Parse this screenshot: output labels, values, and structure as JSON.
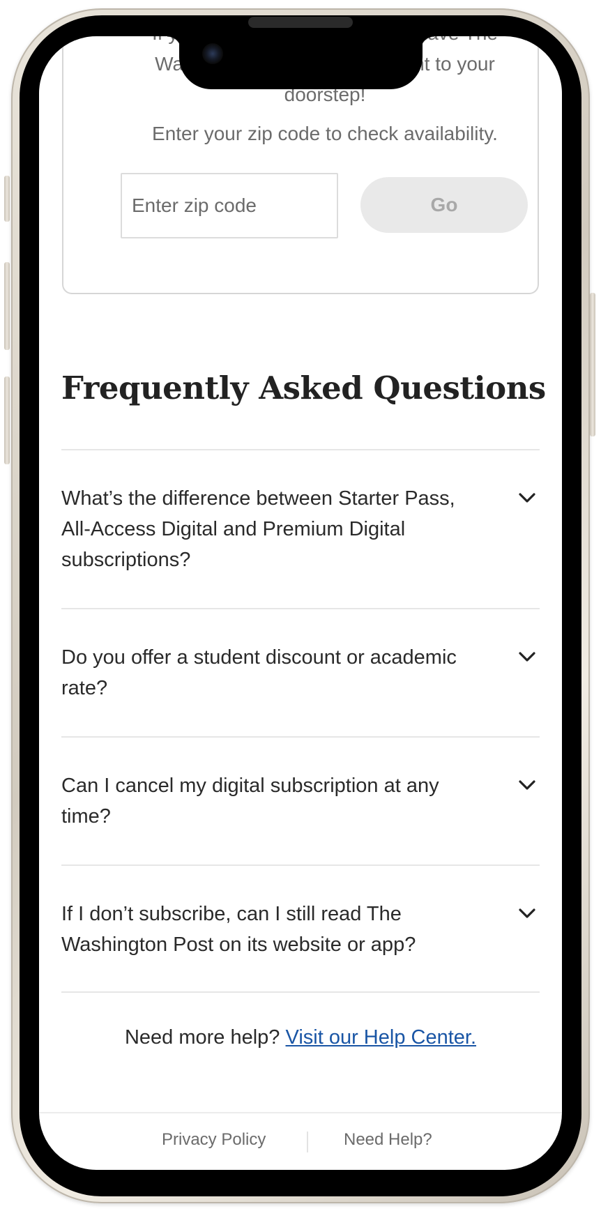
{
  "delivery": {
    "intro": "If you live in our delivery area, have The Washington Post delivered right to your doorstep!",
    "availability": "Enter your zip code to check availability.",
    "zip_placeholder": "Enter zip code",
    "zip_value": "",
    "go_label": "Go"
  },
  "faq": {
    "title": "Frequently Asked Questions",
    "items": [
      {
        "question": "What’s the difference between Starter Pass, All-Access Digital and Premium Digital subscriptions?",
        "icon": "chevron-down-icon"
      },
      {
        "question": "Do you offer a student discount or academic rate?",
        "icon": "chevron-down-icon"
      },
      {
        "question": "Can I cancel my digital subscription at any time?",
        "icon": "chevron-down-icon"
      },
      {
        "question": "If I don’t subscribe, can I still read The Washington Post on its website or app?",
        "icon": "chevron-down-icon"
      }
    ]
  },
  "help": {
    "prompt": "Need more help?",
    "link_text": "Visit our Help Center."
  },
  "footer": {
    "privacy_label": "Privacy Policy",
    "help_label": "Need Help?"
  },
  "colors": {
    "link": "#1955a5",
    "text": "#2a2a2a",
    "muted_text": "#6b6b6b",
    "button_disabled_bg": "#e9e9e9",
    "button_disabled_text": "#a8a8a8",
    "divider": "#e6e6e6"
  }
}
